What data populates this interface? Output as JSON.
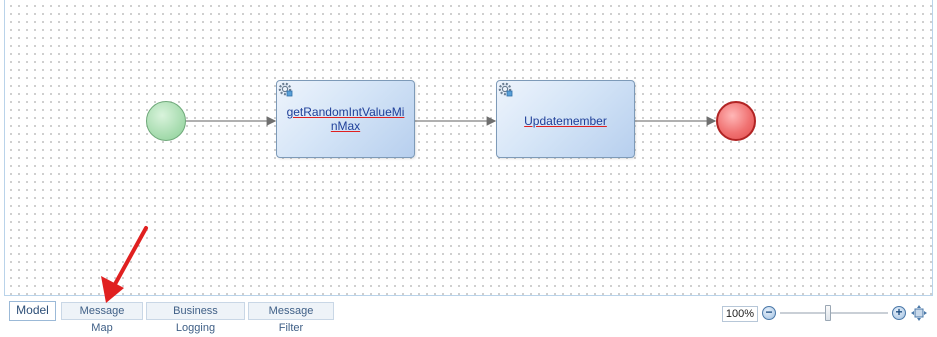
{
  "diagram": {
    "tasks": [
      {
        "label": "getRandomIntValueMinMax",
        "icon": "gear-icon"
      },
      {
        "label": "Updatemember",
        "icon": "gear-icon"
      }
    ],
    "start_event_color": "#a9ddb1",
    "end_event_color": "#e24d4d",
    "task_text_color": "#1f3f99",
    "connector_color": "#808080"
  },
  "tabs": [
    {
      "label": "Model",
      "active": true
    },
    {
      "label": "Message Map",
      "active": false
    },
    {
      "label": "Business Logging",
      "active": false
    },
    {
      "label": "Message Filter",
      "active": false
    }
  ],
  "zoom": {
    "value": "100%",
    "level_fraction": 0.5,
    "out_icon": "minus-icon",
    "in_icon": "plus-icon",
    "fit_icon": "fit-to-screen-icon"
  },
  "annotation": {
    "arrow_color": "#e02020"
  }
}
